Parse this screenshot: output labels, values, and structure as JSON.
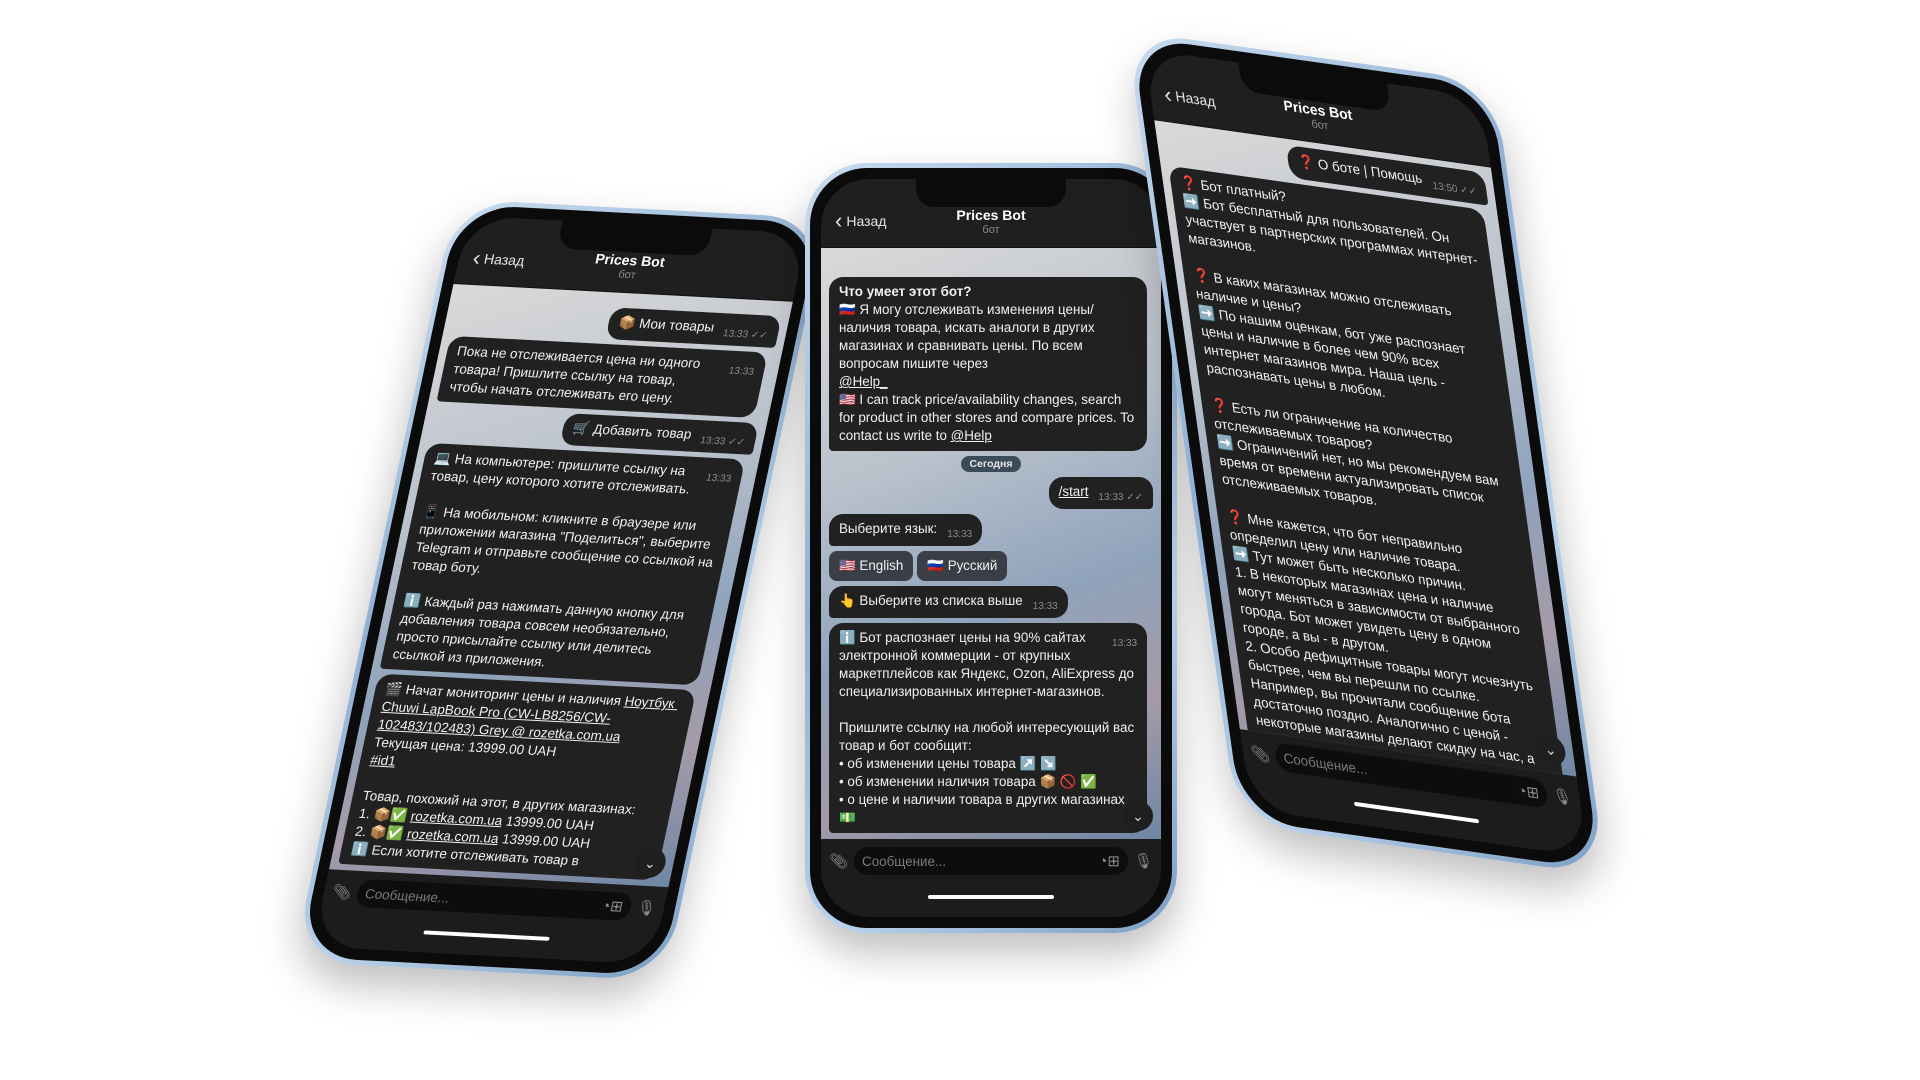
{
  "colors": {
    "bubble": "#212122",
    "header": "#1f1f20",
    "frame": "#8fb0d3"
  },
  "phones": [
    {
      "id": "left",
      "header": {
        "back": "Назад",
        "title": "Prices Bot",
        "subtitle": "бот"
      },
      "align": "end",
      "items": [
        {
          "type": "msg",
          "side": "out",
          "parts": [
            {
              "t": "📦 Мои товары"
            }
          ],
          "time": "13:33",
          "read": "✓✓"
        },
        {
          "type": "msg",
          "side": "in",
          "parts": [
            {
              "t": "Пока не отслеживается цена ни одного товара! Пришлите ссылку на товар, чтобы начать отслеживать его цену."
            }
          ],
          "time": "13:33"
        },
        {
          "type": "msg",
          "side": "out",
          "parts": [
            {
              "t": "🛒 Добавить товар"
            }
          ],
          "time": "13:33",
          "read": "✓✓"
        },
        {
          "type": "msg",
          "side": "in",
          "parts": [
            {
              "t": "💻 На компьютере: пришлите ссылку на товар, цену которого хотите отслеживать.\n\n📱 На мобильном: кликните в браузере или приложении магазина \"Поделиться\", выберите Telegram и отправьте сообщение со ссылкой на товар боту.\n\nℹ️ Каждый раз нажимать данную кнопку для добавления товара совсем необязательно, просто присылайте ссылку или делитесь ссылкой из приложения."
            }
          ],
          "time": "13:33"
        },
        {
          "type": "msg",
          "side": "in",
          "parts": [
            {
              "t": "🎬 Начат мониторинг цены и наличия "
            },
            {
              "t": "Ноутбук Chuwi LapBook Pro (CW-LB8256/CW-102483/102483) Grey @ rozetka.com.ua",
              "link": true
            },
            {
              "t": "\nТекущая цена: 13999.00 UAH\n"
            },
            {
              "t": "#id1",
              "link": true
            },
            {
              "t": "\n\nТовар, похожий на этот, в других магазинах:\n1. 📦✅ "
            },
            {
              "t": "rozetka.com.ua",
              "link": true
            },
            {
              "t": " 13999.00 UAH\n2. 📦✅ "
            },
            {
              "t": "rozetka.com.ua",
              "link": true
            },
            {
              "t": " 13999.00 UAH\nℹ️ Если хотите отслеживать товар в"
            }
          ]
        }
      ],
      "input_placeholder": "Сообщение..."
    },
    {
      "id": "center",
      "header": {
        "back": "Назад",
        "title": "Prices Bot",
        "subtitle": "бот"
      },
      "align": "end",
      "items": [
        {
          "type": "msg",
          "side": "in",
          "parts": [
            {
              "t": "Что умеет этот бот?",
              "bold": true
            },
            {
              "t": "\n🇷🇺 Я могу отслеживать изменения цены/наличия товара, искать аналоги в других магазинах и сравнивать цены. По всем вопросам пишите через\n"
            },
            {
              "t": "@Help_",
              "link": true
            },
            {
              "t": "\n🇺🇸 I can track price/availability changes, search for product in other stores and compare prices. To contact us write to "
            },
            {
              "t": "@Help",
              "link": true
            }
          ]
        },
        {
          "type": "date",
          "label": "Сегодня"
        },
        {
          "type": "msg",
          "side": "out",
          "parts": [
            {
              "t": "/start",
              "link": true
            }
          ],
          "time": "13:33",
          "read": "✓✓"
        },
        {
          "type": "msg",
          "side": "in",
          "parts": [
            {
              "t": "Выберите язык:"
            }
          ],
          "time": "13:33"
        },
        {
          "type": "kbd",
          "buttons": [
            "🇺🇸 English",
            "🇷🇺 Русский"
          ]
        },
        {
          "type": "msg",
          "side": "in",
          "parts": [
            {
              "t": "👆 Выберите из списка выше"
            }
          ],
          "time": "13:33"
        },
        {
          "type": "msg",
          "side": "in",
          "parts": [
            {
              "t": "ℹ️ Бот распознает цены на 90% сайтах электронной коммерции - от крупных маркетплейсов как Яндекс, Ozon, AliExpress до специализированных интернет-магазинов.\n\nПришлите ссылку на любой интересующий вас товар и бот сообщит:\n• об изменении цены товара ↗️ ↘️\n• об изменении наличия товара 📦 🚫 ✅\n• о цене и наличии товара в других магазинах 💵"
            }
          ],
          "time": "13:33"
        }
      ],
      "input_placeholder": "Сообщение..."
    },
    {
      "id": "right",
      "header": {
        "back": "Назад",
        "title": "Prices Bot",
        "subtitle": "бот"
      },
      "align": "start",
      "items": [
        {
          "type": "msg",
          "side": "out",
          "parts": [
            {
              "t": "❓ О боте | Помощь"
            }
          ],
          "time": "13:50",
          "read": "✓✓"
        },
        {
          "type": "msg",
          "side": "in",
          "parts": [
            {
              "t": "❓ Бот платный?\n➡️ Бот бесплатный для пользователей. Он участвует в партнерских программах интернет-магазинов.\n\n❓ В каких магазинах можно отслеживать наличие и цены?\n➡️ По нашим оценкам, бот уже распознает цены и наличие в более чем 90% всех интернет магазинов мира. Наша цель - распознавать цены в любом.\n\n❓ Есть ли ограничение на количество отслеживаемых товаров?\n➡️ Ограничений нет, но мы рекомендуем вам время от времени актуализировать список отслеживаемых товаров.\n\n❓ Мне кажется, что бот неправильно определил цену или наличие товара.\n➡️ Тут может быть несколько причин.\n1. В некоторых магазинах цена и наличие могут меняться в зависимости от выбранного города. Бот может увидеть цену в одном городе, а вы - в другом.\n2. Особо дефицитные товары могут исчезнуть быстрее, чем вы перешли по ссылке. Например, вы прочитали сообщение бота достаточно поздно. Аналогично с ценой - некоторые магазины делают скидку на час, а потом"
            }
          ]
        }
      ],
      "input_placeholder": "Сообщение..."
    }
  ]
}
